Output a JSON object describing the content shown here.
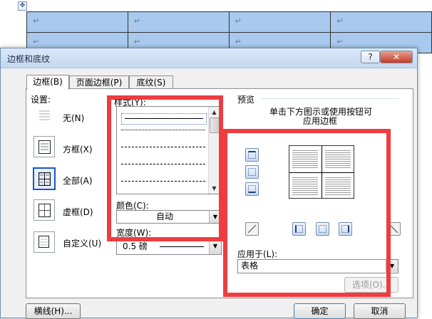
{
  "document": {
    "row_marks": [
      [
        "↵",
        "↵",
        "↵",
        "↵",
        "↵"
      ],
      [
        "↵",
        "↵",
        "↵",
        "↵",
        "↵"
      ]
    ]
  },
  "dialog": {
    "title": "边框和底纹",
    "help_label": "?",
    "close_label": "✕",
    "tabs": [
      {
        "label": "边框(B)",
        "active": true
      },
      {
        "label": "页面边框(P)",
        "active": false
      },
      {
        "label": "底纹(S)",
        "active": false
      }
    ],
    "settings_label": "设置:",
    "settings": [
      {
        "label": "无(N)",
        "selected": false
      },
      {
        "label": "方框(X)",
        "selected": false
      },
      {
        "label": "全部(A)",
        "selected": true
      },
      {
        "label": "虚框(D)",
        "selected": false
      },
      {
        "label": "自定义(U)",
        "selected": false
      }
    ],
    "style_label": "样式(Y):",
    "color_label": "颜色(C):",
    "color_value": "自动",
    "width_label": "宽度(W):",
    "width_value": "0.5 磅",
    "preview_label": "预览",
    "preview_hint_line1": "单击下方图示或使用按钮可",
    "preview_hint_line2": "应用边框",
    "apply_to_label": "应用于(L):",
    "apply_to_value": "表格",
    "options_button": "选项(O)...",
    "horizontal_line_button": "横线(H)...",
    "ok_button": "确定",
    "cancel_button": "取消"
  },
  "colors": {
    "highlight_red": "#ee3c41",
    "table_fill": "#a9c9ee",
    "selection_blue": "#1c58c4"
  }
}
